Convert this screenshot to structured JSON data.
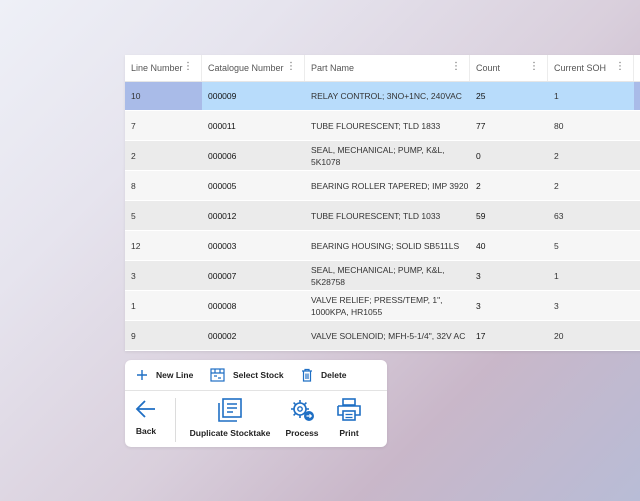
{
  "table": {
    "columns": [
      "Line Number",
      "Catalogue Number",
      "Part Name",
      "Count",
      "Current SOH",
      ""
    ],
    "rows": [
      {
        "line": "10",
        "catalogue": "000009",
        "part": [
          "RELAY CONTROL; 3NO+1NC, 240VAC"
        ],
        "count": "25",
        "soh": "1",
        "selected": true
      },
      {
        "line": "7",
        "catalogue": "000011",
        "part": [
          "TUBE FLOURESCENT; TLD 1833"
        ],
        "count": "77",
        "soh": "80"
      },
      {
        "line": "2",
        "catalogue": "000006",
        "part": [
          "SEAL, MECHANICAL; PUMP, K&L,",
          "5K1078"
        ],
        "count": "0",
        "soh": "2"
      },
      {
        "line": "8",
        "catalogue": "000005",
        "part": [
          "BEARING ROLLER TAPERED; IMP 3920"
        ],
        "count": "2",
        "soh": "2"
      },
      {
        "line": "5",
        "catalogue": "000012",
        "part": [
          "TUBE FLOURESCENT; TLD 1033"
        ],
        "count": "59",
        "soh": "63"
      },
      {
        "line": "12",
        "catalogue": "000003",
        "part": [
          "BEARING HOUSING; SOLID SB511LS"
        ],
        "count": "40",
        "soh": "5"
      },
      {
        "line": "3",
        "catalogue": "000007",
        "part": [
          "SEAL, MECHANICAL; PUMP, K&L,",
          "5K28758"
        ],
        "count": "3",
        "soh": "1"
      },
      {
        "line": "1",
        "catalogue": "000008",
        "part": [
          "VALVE RELIEF; PRESS/TEMP, 1\",",
          "1000KPA, HR1055"
        ],
        "count": "3",
        "soh": "3"
      },
      {
        "line": "9",
        "catalogue": "000002",
        "part": [
          "VALVE SOLENOID; MFH-5-1/4\", 32V AC"
        ],
        "count": "17",
        "soh": "20"
      }
    ]
  },
  "toolbar": {
    "new_line": "New Line",
    "select_stock": "Select Stock",
    "delete": "Delete",
    "back": "Back",
    "duplicate": "Duplicate Stocktake",
    "process": "Process",
    "print": "Print"
  },
  "icons": {
    "column_menu": "more-vert-icon",
    "new_line": "plus-icon",
    "select_stock": "inventory-icon",
    "delete": "trash-icon",
    "back": "arrow-left-icon",
    "duplicate": "copy-document-icon",
    "process": "gears-icon",
    "print": "printer-icon"
  },
  "colors": {
    "accent": "#1f6fc4",
    "selected_row_light": "#b8dcfb",
    "selected_row_dark": "#a9bbe8",
    "row_odd": "#f6f6f6",
    "row_even": "#ebebeb"
  }
}
